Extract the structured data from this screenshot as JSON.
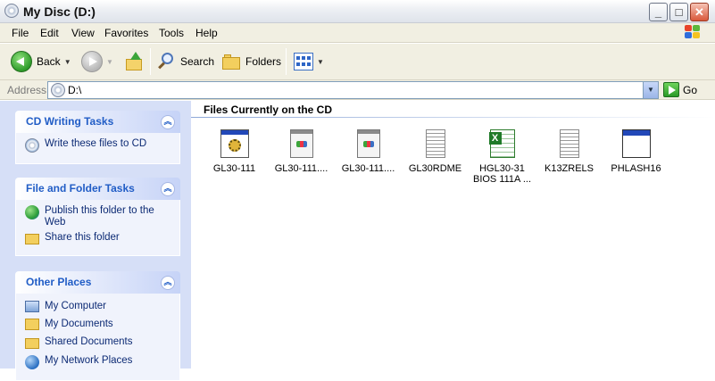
{
  "window": {
    "title": "My Disc (D:)"
  },
  "menu": [
    "File",
    "Edit",
    "View",
    "Favorites",
    "Tools",
    "Help"
  ],
  "toolbar": {
    "back": "Back",
    "search": "Search",
    "folders": "Folders"
  },
  "address": {
    "label": "Address",
    "value": "D:\\",
    "go": "Go"
  },
  "tasks": {
    "cd_writing": {
      "title": "CD Writing Tasks",
      "items": [
        "Write these files to CD"
      ]
    },
    "file_folder": {
      "title": "File and Folder Tasks",
      "items": [
        "Publish this folder to the Web",
        "Share this folder"
      ]
    },
    "other_places": {
      "title": "Other Places",
      "items": [
        "My Computer",
        "My Documents",
        "Shared Documents",
        "My Network Places"
      ]
    }
  },
  "content": {
    "group_title": "Files Currently on the CD",
    "files": [
      {
        "name": "GL30-111",
        "icon": "exe-gear-icon"
      },
      {
        "name": "GL30-111....",
        "icon": "batch-file-icon"
      },
      {
        "name": "GL30-111....",
        "icon": "batch-file-icon"
      },
      {
        "name": "GL30RDME",
        "icon": "text-file-icon"
      },
      {
        "name": "HGL30-31 BIOS 111A ...",
        "icon": "excel-file-icon"
      },
      {
        "name": "K13ZRELS",
        "icon": "text-file-icon"
      },
      {
        "name": "PHLASH16",
        "icon": "application-window-icon"
      }
    ]
  }
}
